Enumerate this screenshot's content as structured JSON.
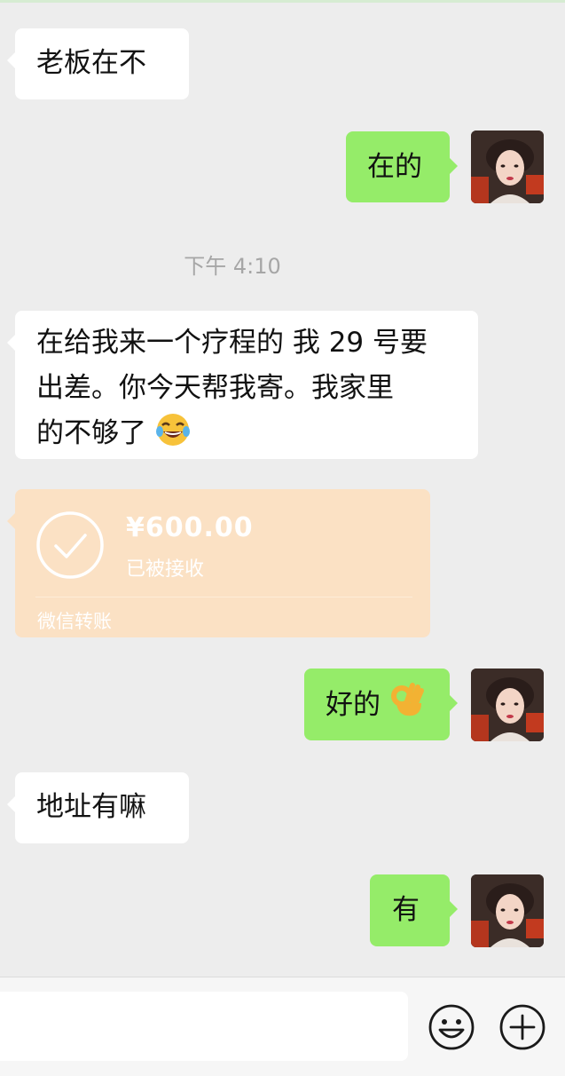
{
  "conversation": {
    "m1": {
      "text": "老板在不"
    },
    "m2": {
      "text": "在的"
    },
    "timestamp": "下午 4:10",
    "m3": {
      "line1": "在给我来一个疗程的 我 29 号要",
      "line2": "出差。你今天帮我寄。我家里",
      "line3": "的不够了",
      "emoji": "face-with-tears-of-joy-emoji"
    },
    "transfer": {
      "amount": "¥600.00",
      "status": "已被接收",
      "source": "微信转账",
      "color": "#fbe1c4"
    },
    "m5": {
      "text": "好的",
      "emoji": "ok-hand-emoji"
    },
    "m6": {
      "text": "地址有嘛"
    },
    "m7": {
      "text": "有"
    }
  },
  "colors": {
    "background": "#ededed",
    "incoming_bubble": "#ffffff",
    "outgoing_bubble": "#95ec69",
    "timestamp": "#a6a6a6"
  },
  "input_bar": {
    "emoji_button_icon": "smiley-face-icon",
    "more_button_icon": "plus-circle-icon"
  }
}
